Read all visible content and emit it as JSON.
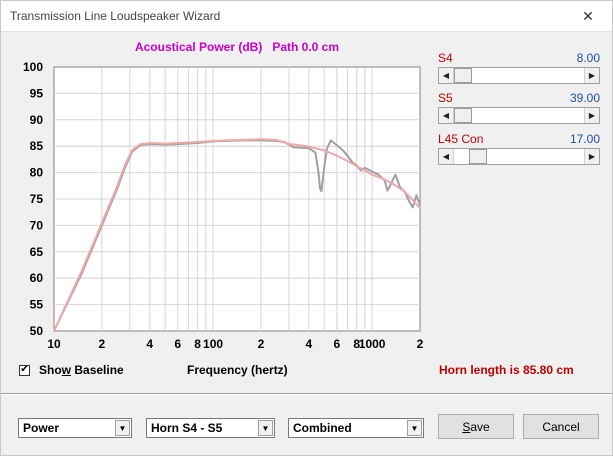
{
  "window": {
    "title": "Transmission Line Loudspeaker Wizard",
    "close_glyph": "✕"
  },
  "chart_data": {
    "type": "line",
    "title": "Acoustical Power (dB)   Path 0.0 cm",
    "xlabel": "Frequency (hertz)",
    "ylabel": "",
    "x_scale": "log",
    "xlim": [
      10,
      2000
    ],
    "ylim": [
      50,
      100
    ],
    "y_ticks": [
      50,
      55,
      60,
      65,
      70,
      75,
      80,
      85,
      90,
      95,
      100
    ],
    "x_tick_labels": [
      {
        "x": 10,
        "label": "10"
      },
      {
        "x": 20,
        "label": "2"
      },
      {
        "x": 40,
        "label": "4"
      },
      {
        "x": 60,
        "label": "6"
      },
      {
        "x": 80,
        "label": "8"
      },
      {
        "x": 100,
        "label": "100"
      },
      {
        "x": 200,
        "label": "2"
      },
      {
        "x": 400,
        "label": "4"
      },
      {
        "x": 600,
        "label": "6"
      },
      {
        "x": 800,
        "label": "8"
      },
      {
        "x": 1000,
        "label": "1000"
      },
      {
        "x": 2000,
        "label": "2"
      }
    ],
    "grid": true,
    "series": [
      {
        "color": "#a0a0a0",
        "points": [
          [
            10,
            50
          ],
          [
            15,
            61
          ],
          [
            20,
            70
          ],
          [
            25,
            77
          ],
          [
            28,
            81
          ],
          [
            31,
            84
          ],
          [
            35,
            85.2
          ],
          [
            40,
            85.4
          ],
          [
            50,
            85.3
          ],
          [
            60,
            85.4
          ],
          [
            80,
            85.6
          ],
          [
            100,
            85.9
          ],
          [
            150,
            86.1
          ],
          [
            200,
            86.1
          ],
          [
            250,
            86.0
          ],
          [
            280,
            85.8
          ],
          [
            320,
            84.8
          ],
          [
            400,
            84.6
          ],
          [
            440,
            83.8
          ],
          [
            460,
            80
          ],
          [
            470,
            77
          ],
          [
            480,
            76.5
          ],
          [
            495,
            80
          ],
          [
            520,
            84.5
          ],
          [
            550,
            86.1
          ],
          [
            600,
            85.2
          ],
          [
            650,
            84.3
          ],
          [
            700,
            83.2
          ],
          [
            750,
            82.0
          ],
          [
            800,
            81.3
          ],
          [
            850,
            80.4
          ],
          [
            900,
            80.9
          ],
          [
            1000,
            80.2
          ],
          [
            1100,
            79.6
          ],
          [
            1200,
            78.5
          ],
          [
            1250,
            76.6
          ],
          [
            1300,
            77.6
          ],
          [
            1400,
            79.6
          ],
          [
            1500,
            77.2
          ],
          [
            1600,
            76.4
          ],
          [
            1700,
            74.7
          ],
          [
            1800,
            73.4
          ],
          [
            1900,
            75.7
          ],
          [
            2000,
            73.8
          ]
        ]
      },
      {
        "color": "#f0a8a8",
        "points": [
          [
            10,
            50
          ],
          [
            15,
            61.5
          ],
          [
            20,
            70.5
          ],
          [
            25,
            77.5
          ],
          [
            28,
            81.5
          ],
          [
            31,
            84.3
          ],
          [
            35,
            85.4
          ],
          [
            40,
            85.6
          ],
          [
            50,
            85.5
          ],
          [
            60,
            85.6
          ],
          [
            80,
            85.8
          ],
          [
            100,
            86.0
          ],
          [
            150,
            86.2
          ],
          [
            200,
            86.3
          ],
          [
            250,
            86.2
          ],
          [
            300,
            85.4
          ],
          [
            350,
            85.2
          ],
          [
            400,
            84.9
          ],
          [
            500,
            84.2
          ],
          [
            600,
            83.2
          ],
          [
            700,
            82.2
          ],
          [
            800,
            81.2
          ],
          [
            900,
            80.4
          ],
          [
            1000,
            79.6
          ],
          [
            1200,
            78.7
          ],
          [
            1400,
            77.6
          ],
          [
            1600,
            76.4
          ],
          [
            1800,
            74.8
          ],
          [
            2000,
            73.3
          ]
        ]
      }
    ]
  },
  "sliders": [
    {
      "label": "S4",
      "value": "8.00",
      "position": 0.0
    },
    {
      "label": "S5",
      "value": "39.00",
      "position": 0.0
    },
    {
      "label": "L45  Con",
      "value": "17.00",
      "position": 0.13
    }
  ],
  "show_baseline": {
    "checked": true,
    "check_glyph": "✔",
    "label_pre": "Show",
    "label_ul": "w",
    "label_post": " Baseline",
    "label_pre2": "Sho"
  },
  "horn_length": "Horn length is 85.80 cm",
  "combos": [
    {
      "value": "Power",
      "arrow": "▼"
    },
    {
      "value": "Horn S4 - S5",
      "arrow": "▼"
    },
    {
      "value": "Combined",
      "arrow": "▼"
    }
  ],
  "buttons": {
    "save_ul": "S",
    "save_rest": "ave",
    "cancel": "Cancel"
  },
  "icons": {
    "scroll_left": "◀",
    "scroll_right": "▶"
  }
}
